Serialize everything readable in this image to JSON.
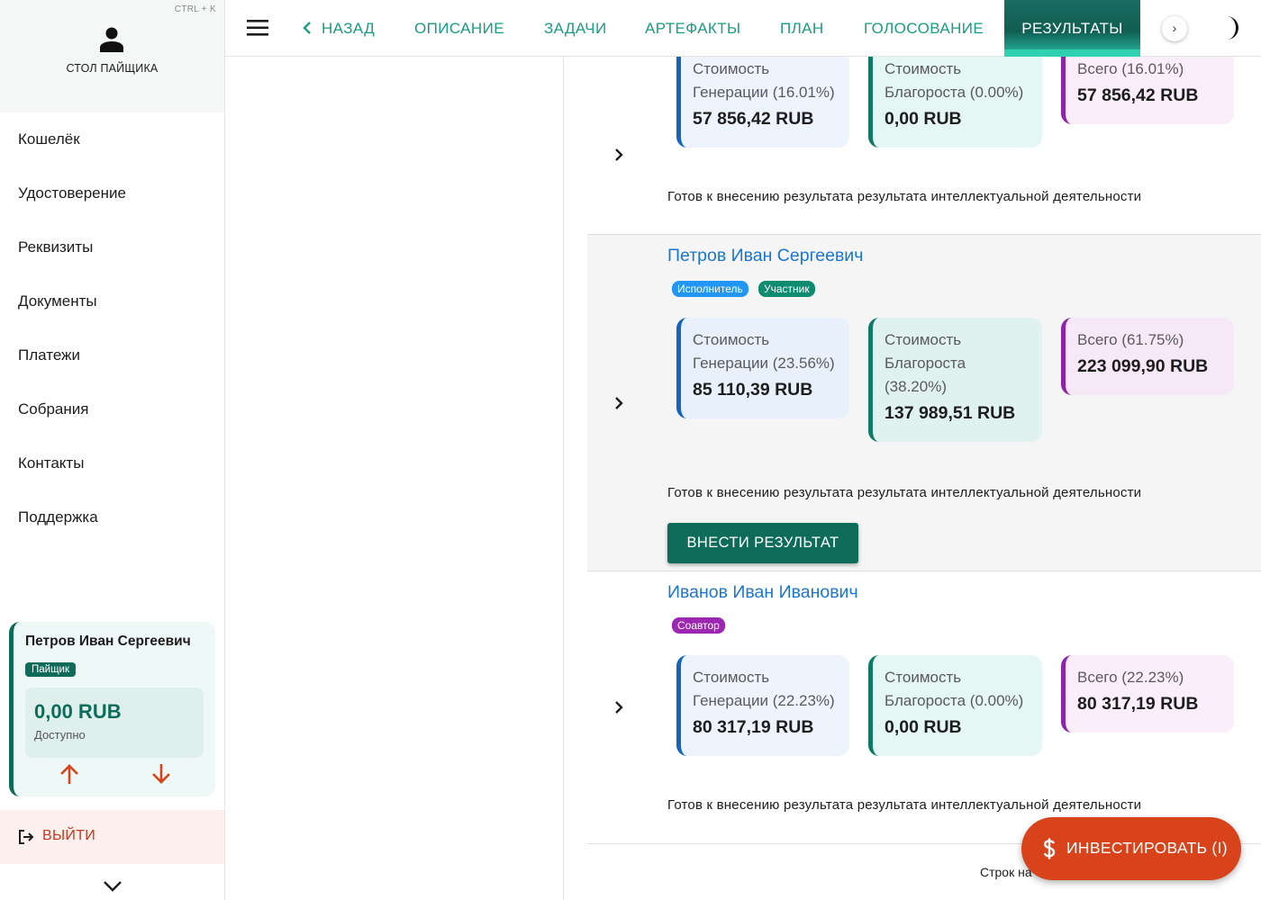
{
  "sidebar": {
    "shortcut": "CTRL + K",
    "desk_title": "СТОЛ ПАЙЩИКА",
    "nav": [
      "Кошелёк",
      "Удостоверение",
      "Реквизиты",
      "Документы",
      "Платежи",
      "Собрания",
      "Контакты",
      "Поддержка"
    ],
    "wallet": {
      "name": "Петров Иван Сергеевич",
      "badge": "Пайщик",
      "amount": "0,00 RUB",
      "amount_label": "Доступно"
    },
    "logout": "ВЫЙТИ"
  },
  "topbar": {
    "back": "НАЗАД",
    "tabs": [
      "ОПИСАНИЕ",
      "ЗАДАЧИ",
      "АРТЕФАКТЫ",
      "ПЛАН",
      "ГОЛОСОВАНИЕ"
    ],
    "active_tab": "РЕЗУЛЬТАТЫ",
    "next": "›"
  },
  "rows": [
    {
      "gen_label": "Стоимость Генерации (16.01%)",
      "gen_value": "57 856,42 RUB",
      "blag_label": "Стоимость Благороста (0.00%)",
      "blag_value": "0,00 RUB",
      "total_label": "Всего (16.01%)",
      "total_value": "57 856,42 RUB",
      "status": "Готов к внесению результата результата интеллектуальной деятельности"
    },
    {
      "name": "Петров Иван Сергеевич",
      "badges": [
        "Исполнитель",
        "Участник"
      ],
      "gen_label": "Стоимость Генерации (23.56%)",
      "gen_value": "85 110,39 RUB",
      "blag_label": "Стоимость Благороста (38.20%)",
      "blag_value": "137 989,51 RUB",
      "total_label": "Всего (61.75%)",
      "total_value": "223 099,90 RUB",
      "status": "Готов к внесению результата результата интеллектуальной деятельности",
      "action": "ВНЕСТИ РЕЗУЛЬТАТ"
    },
    {
      "name": "Иванов Иван Иванович",
      "badges": [
        "Соавтор"
      ],
      "gen_label": "Стоимость Генерации (22.23%)",
      "gen_value": "80 317,19 RUB",
      "blag_label": "Стоимость Благороста (0.00%)",
      "blag_value": "0,00 RUB",
      "total_label": "Всего (22.23%)",
      "total_value": "80 317,19 RUB",
      "status": "Готов к внесению результата результата интеллектуальной деятельности"
    }
  ],
  "footer": {
    "rows_per_page_label": "Строк на"
  },
  "invest_button": "ИНВЕСТИРОВАТЬ (I)",
  "colors": {
    "brand": "#0e6b5a",
    "accent_tab": "#1a9c82",
    "link": "#1976d2",
    "danger": "#d8431b"
  }
}
